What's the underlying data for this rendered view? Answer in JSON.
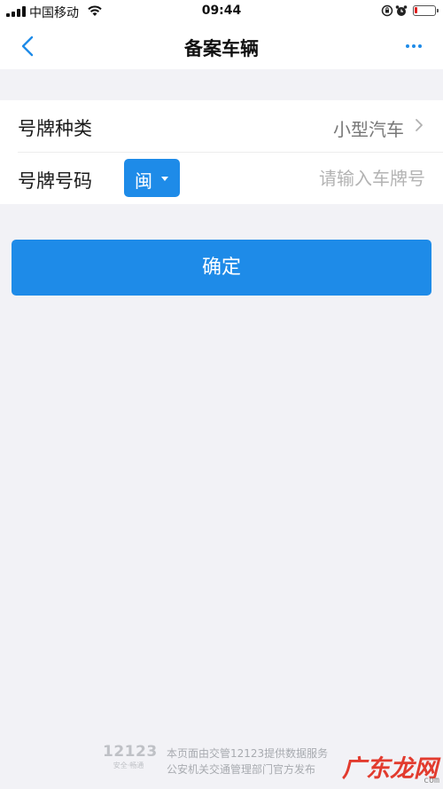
{
  "status_bar": {
    "carrier": "中国移动",
    "time": "09:44",
    "battery_level": 0.15,
    "battery_color": "#e02020"
  },
  "nav": {
    "title": "备案车辆",
    "back_icon": "chevron-left-icon",
    "more_icon": "ellipsis-icon"
  },
  "form": {
    "plate_type_label": "号牌种类",
    "plate_type_value": "小型汽车",
    "plate_number_label": "号牌号码",
    "province": "闽",
    "plate_number_placeholder": "请输入车牌号",
    "plate_number_value": ""
  },
  "actions": {
    "confirm_label": "确定"
  },
  "footer": {
    "logo_number": "12123",
    "logo_tagline": "安全·畅通",
    "line1": "本页面由交管12123提供数据服务",
    "line2": "公安机关交通管理部门官方发布"
  },
  "watermark": {
    "text": "广东龙网",
    "domain": "com"
  },
  "colors": {
    "accent": "#1e8be8",
    "background": "#f2f2f6",
    "surface": "#ffffff"
  }
}
